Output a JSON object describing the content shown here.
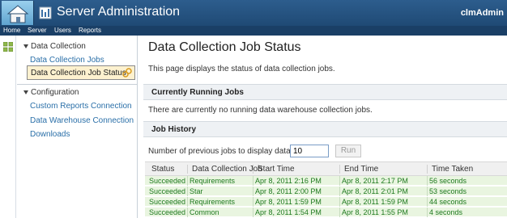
{
  "header": {
    "app_title": "Server Administration",
    "user": "clmAdmin"
  },
  "nav": {
    "items": [
      "Home",
      "Server",
      "Users",
      "Reports"
    ]
  },
  "sidebar": {
    "sections": [
      {
        "title": "Data Collection",
        "items": [
          "Data Collection Jobs",
          "Data Collection Job Status"
        ]
      },
      {
        "title": "Configuration",
        "items": [
          "Custom Reports Connection",
          "Data Warehouse Connection",
          "Downloads"
        ]
      }
    ]
  },
  "main": {
    "title": "Data Collection Job Status",
    "description": "This page displays the status of data collection jobs.",
    "running": {
      "header": "Currently Running Jobs",
      "message": "There are currently no running data warehouse collection jobs."
    },
    "history": {
      "header": "Job History",
      "jobs_label": "Number of previous jobs to display data for",
      "jobs_value": "10",
      "run_label": "Run",
      "columns": [
        "Status",
        "Data Collection Job",
        "Start Time",
        "End Time",
        "Time Taken"
      ],
      "rows": [
        [
          "Succeeded",
          "Requirements",
          "Apr 8, 2011 2:16 PM",
          "Apr 8, 2011 2:17 PM",
          "56 seconds"
        ],
        [
          "Succeeded",
          "Star",
          "Apr 8, 2011 2:00 PM",
          "Apr 8, 2011 2:01 PM",
          "53 seconds"
        ],
        [
          "Succeeded",
          "Requirements",
          "Apr 8, 2011 1:59 PM",
          "Apr 8, 2011 1:59 PM",
          "44 seconds"
        ],
        [
          "Succeeded",
          "Common",
          "Apr 8, 2011 1:54 PM",
          "Apr 8, 2011 1:55 PM",
          "4 seconds"
        ]
      ]
    }
  },
  "colors": {
    "banner": "#2d5d8d",
    "link": "#2a6fa8",
    "success_text": "#1f7a1f",
    "success_row": "#e9f5e0",
    "active_item": "#fdf1cf"
  }
}
